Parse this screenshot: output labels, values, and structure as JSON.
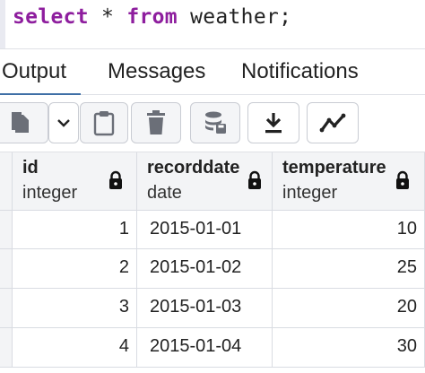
{
  "editor": {
    "tokens": [
      "select",
      " * ",
      "from",
      " weather;"
    ]
  },
  "tabs": [
    {
      "label": "Output",
      "active": true
    },
    {
      "label": "Messages",
      "active": false
    },
    {
      "label": "Notifications",
      "active": false
    }
  ],
  "toolbar": {
    "icons": [
      "copy-icon",
      "chevron-down-icon",
      "paste-icon",
      "delete-icon",
      "save-data-icon",
      "download-icon",
      "graph-icon"
    ]
  },
  "table": {
    "columns": [
      {
        "name": "id",
        "type": "integer"
      },
      {
        "name": "recorddate",
        "type": "date"
      },
      {
        "name": "temperature",
        "type": "integer"
      }
    ],
    "rows": [
      [
        "1",
        "2015-01-01",
        "10"
      ],
      [
        "2",
        "2015-01-02",
        "25"
      ],
      [
        "3",
        "2015-01-03",
        "20"
      ],
      [
        "4",
        "2015-01-04",
        "30"
      ]
    ]
  },
  "colors": {
    "keyword": "#8e1e9e",
    "active_tab_underline": "#3f6fa6",
    "header_bg": "#f3f4f6",
    "border": "#d9dce2"
  }
}
